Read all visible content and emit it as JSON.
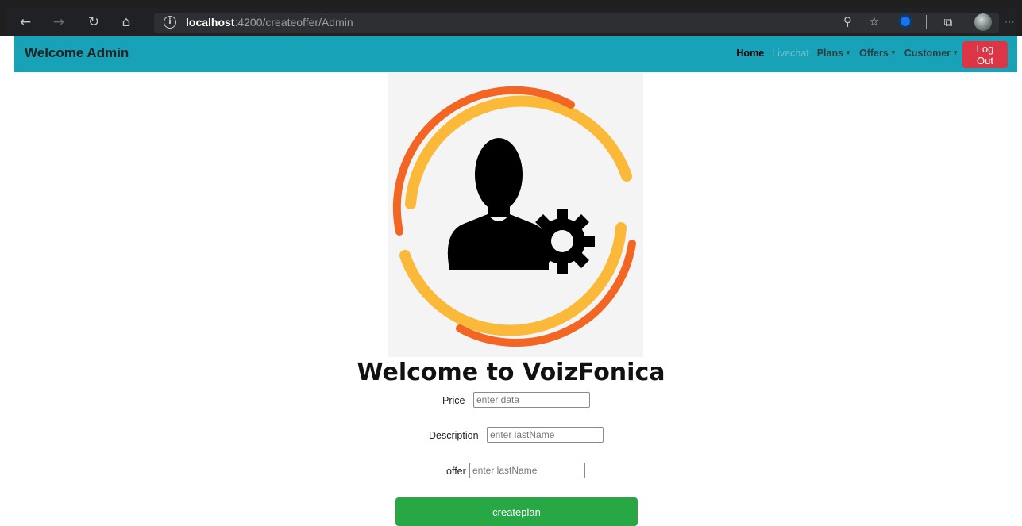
{
  "browser": {
    "url_host": "localhost",
    "url_path": ":4200/createoffer/Admin"
  },
  "navbar": {
    "brand": "Welcome Admin",
    "links": {
      "home": "Home",
      "livechat": "Livechat",
      "plans": "Plans",
      "offers": "Offers",
      "customer": "Customer"
    },
    "logout_label": "Log Out",
    "color": "#17a2b8"
  },
  "main": {
    "heading": "Welcome to VoizFonica",
    "form": {
      "price_label": "Price",
      "price_placeholder": "enter data",
      "description_label": "Description",
      "description_placeholder": "enter lastName",
      "offer_label": "offer",
      "offer_placeholder": "enter lastName",
      "submit_label": "createplan"
    }
  },
  "colors": {
    "logout": "#dc3545",
    "submit": "#28a745",
    "ring_orange": "#f26522",
    "ring_yellow": "#fbb93a"
  }
}
